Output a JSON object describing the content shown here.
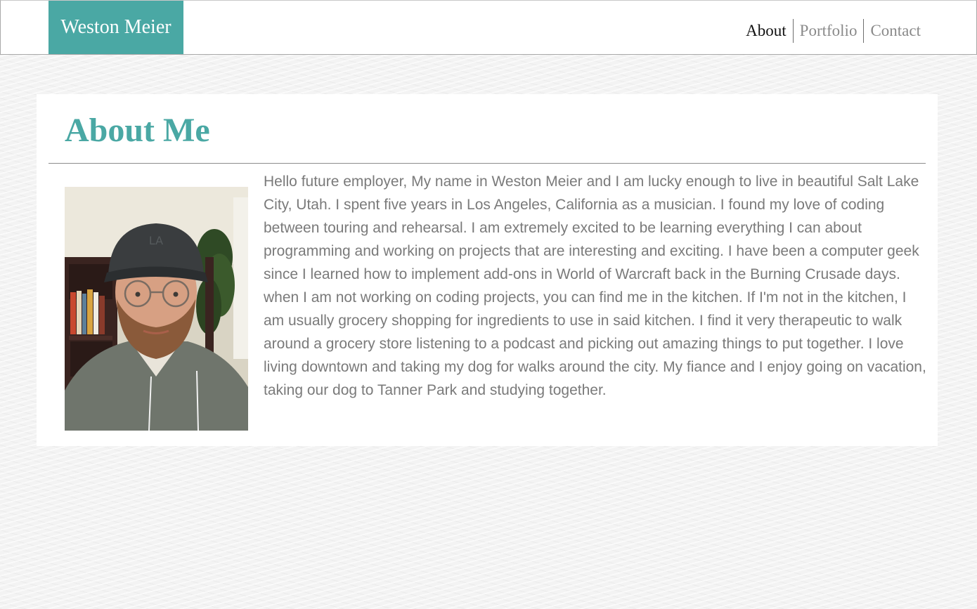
{
  "header": {
    "brand": "Weston Meier",
    "nav": [
      "About",
      "Portfolio",
      "Contact"
    ]
  },
  "about": {
    "title": "About Me",
    "bio": "Hello future employer, My name in Weston Meier and I am lucky enough to live in beautiful Salt Lake City, Utah. I spent five years in Los Angeles, California as a musician. I found my love of coding between touring and rehearsal. I am extremely excited to be learning everything I can about programming and working on projects that are interesting and exciting. I have been a computer geek since I learned how to implement add-ons in World of Warcraft back in the Burning Crusade days. when I am not working on coding projects, you can find me in the kitchen. If I'm not in the kitchen, I am usually grocery shopping for ingredients to use in said kitchen. I find it very therapeutic to walk around a grocery store listening to a podcast and picking out amazing things to put together. I love living downtown and taking my dog for walks around the city. My fiance and I enjoy going on vacation, taking our dog to Tanner Park and studying together."
  },
  "colors": {
    "accent": "#4aa8a4",
    "body_text": "#7a7a7a",
    "nav_active": "#111111",
    "nav_inactive": "#8a8a8a"
  }
}
